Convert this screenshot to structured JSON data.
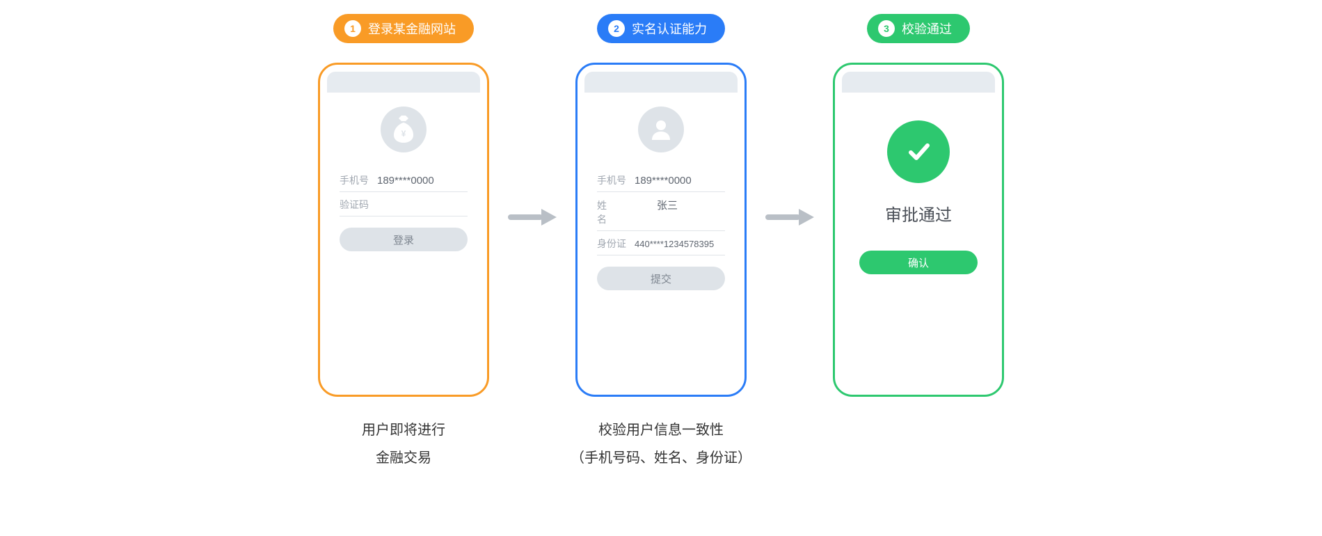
{
  "steps": [
    {
      "badge_num": "1",
      "badge_label": "登录某金融网站",
      "phone": {
        "phone_label": "手机号",
        "phone_value": "189****0000",
        "code_label": "验证码",
        "login_btn": "登录"
      },
      "caption": "用户即将进行\n金融交易"
    },
    {
      "badge_num": "2",
      "badge_label": "实名认证能力",
      "phone": {
        "phone_label": "手机号",
        "phone_value": "189****0000",
        "name_label": "姓 名",
        "name_value": "张三",
        "id_label": "身份证",
        "id_value": "440****1234578395",
        "submit_btn": "提交"
      },
      "caption": "校验用户信息一致性\n（手机号码、姓名、身份证）"
    },
    {
      "badge_num": "3",
      "badge_label": "校验通过",
      "phone": {
        "result_title": "审批通过",
        "confirm_btn": "确认"
      },
      "caption": ""
    }
  ]
}
